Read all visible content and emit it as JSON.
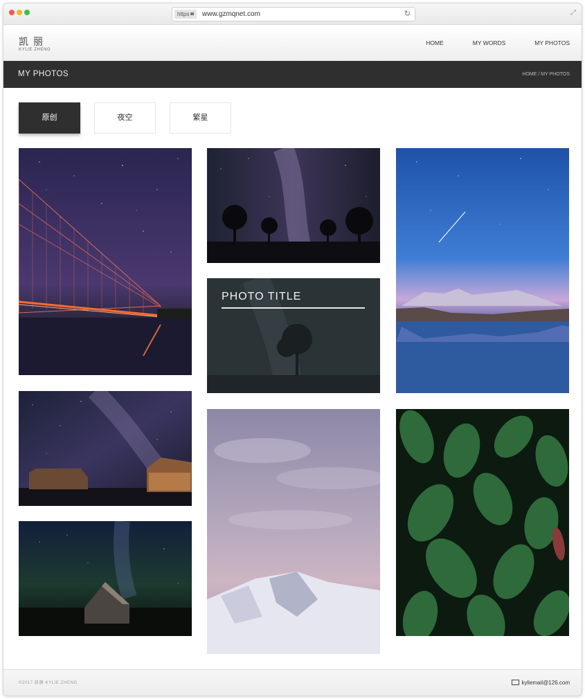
{
  "browser": {
    "https_label": "https",
    "url": "www.gzmqnet.com",
    "reload_glyph": "↻",
    "expand_glyph": "⤢"
  },
  "header": {
    "logo_cn": "凯丽",
    "logo_en": "KYLIE ZHENG",
    "nav": [
      "HOME",
      "MY WORDS",
      "MY PHOTOS"
    ]
  },
  "title_bar": {
    "title": "MY PHOTOS",
    "breadcrumb_home": "HOME",
    "breadcrumb_sep": " / ",
    "breadcrumb_current": "MY PHOTOS"
  },
  "filters": [
    {
      "label": "原创",
      "active": true
    },
    {
      "label": "夜空",
      "active": false
    },
    {
      "label": "繁星",
      "active": false
    }
  ],
  "gallery": {
    "overlay_title": "PHOTO TITLE"
  },
  "footer": {
    "copyright": "©2017 凯丽 KYLIE ZHENG",
    "email": "kyliemail@126.com"
  }
}
